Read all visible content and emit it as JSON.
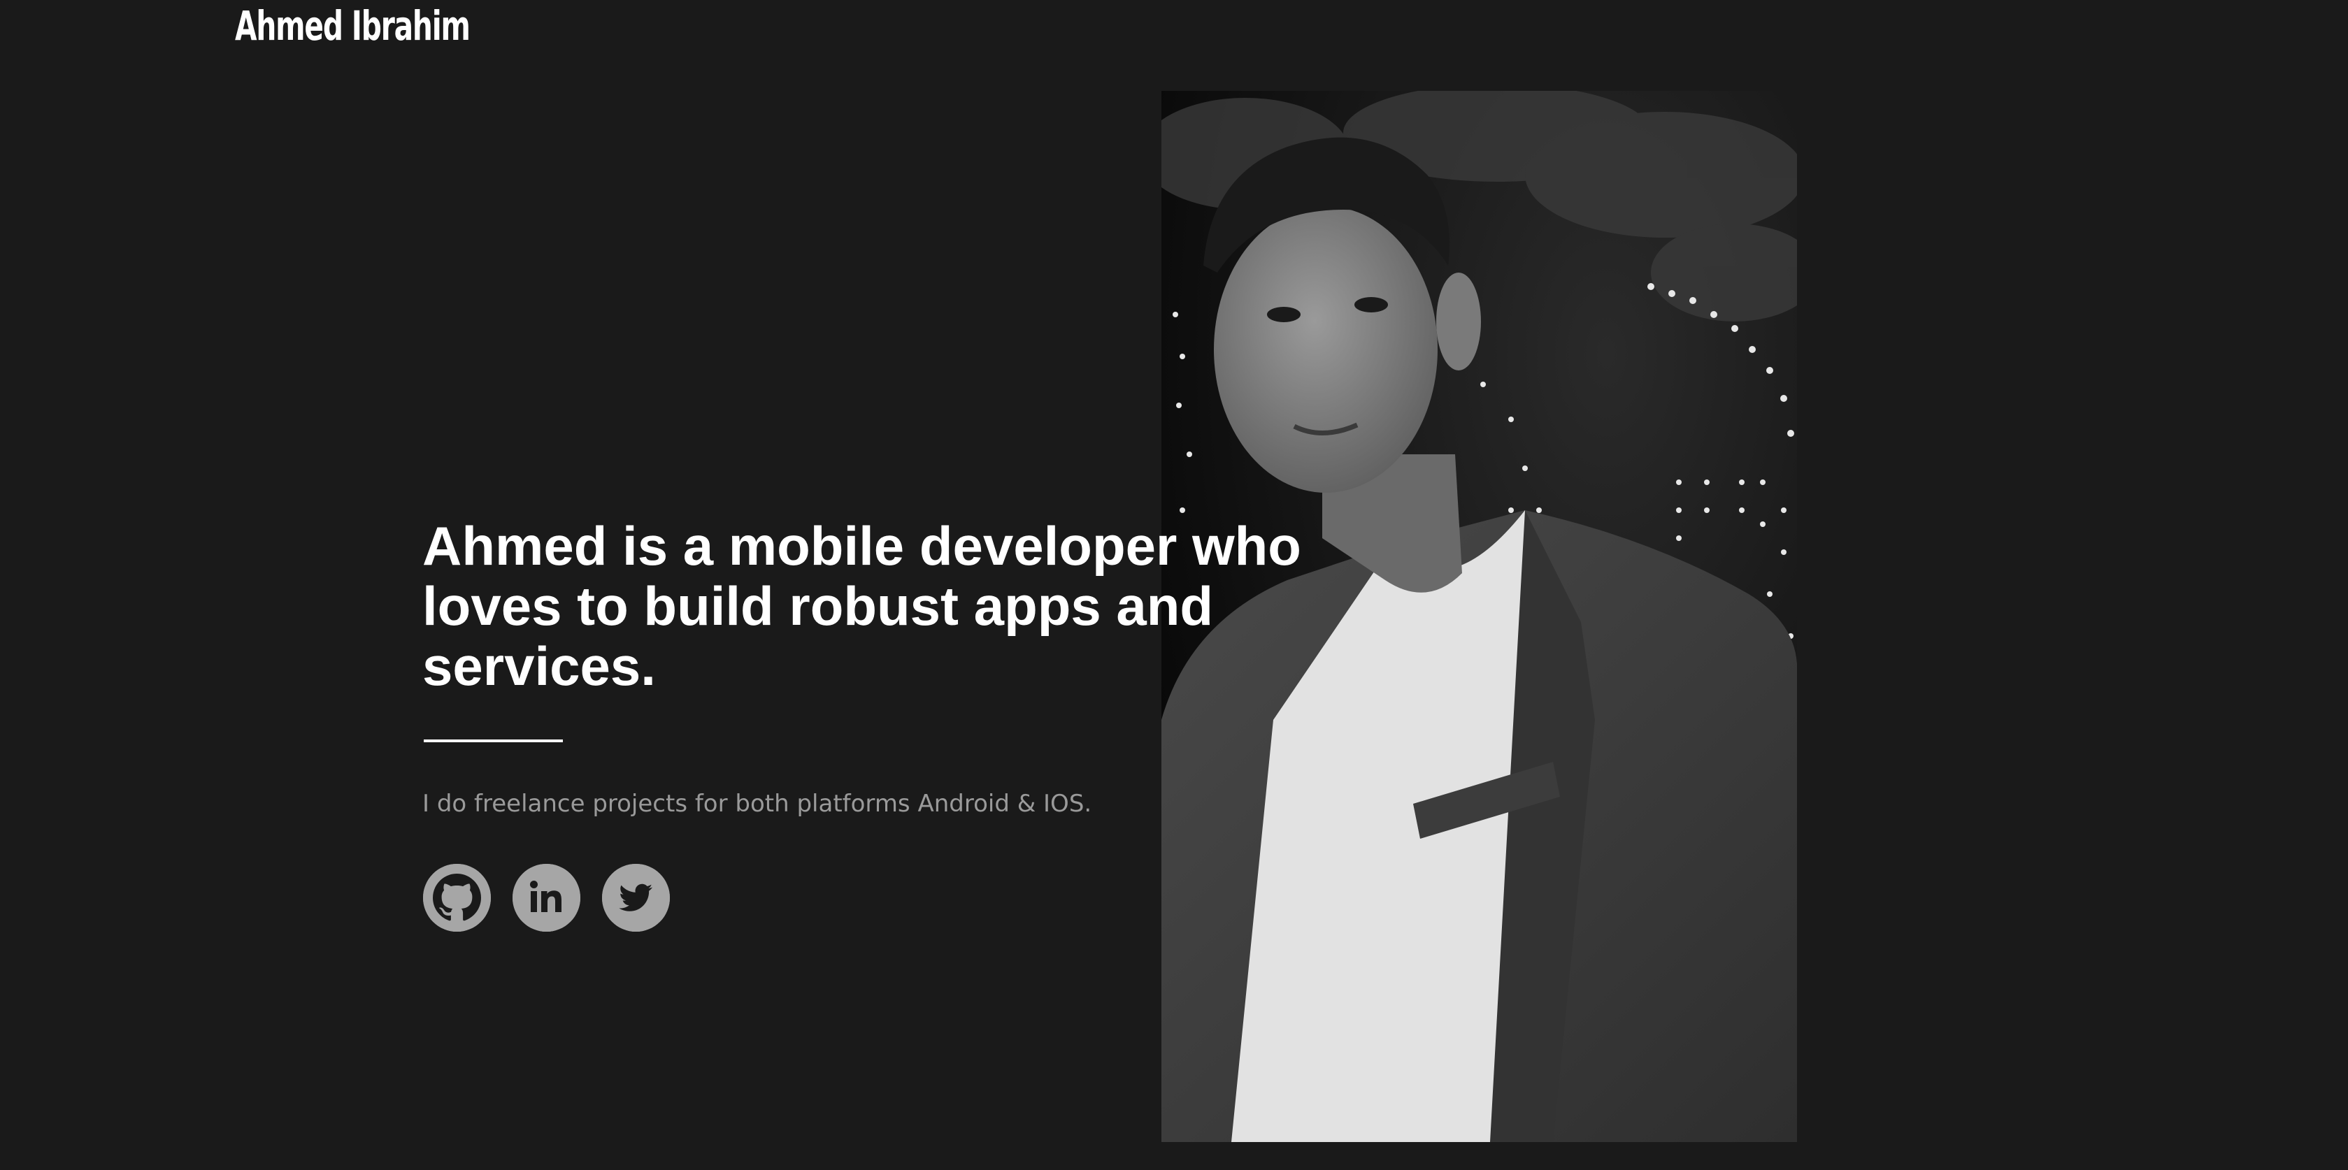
{
  "header": {
    "brand": "Ahmed Ibrahim"
  },
  "hero": {
    "headline_lines": [
      "Ahmed is a mobile developer who",
      "loves to build robust apps and",
      "services."
    ],
    "tagline": "I do freelance projects for both platforms Android & IOS.",
    "photo_icon": "portrait-photo"
  },
  "social": [
    {
      "icon": "github-icon"
    },
    {
      "icon": "linkedin-icon"
    },
    {
      "icon": "twitter-icon"
    }
  ],
  "colors": {
    "background": "#1a1a1a",
    "text": "#ffffff",
    "muted_text": "#9a9a9a",
    "social_icon_bg": "#a6a6a6",
    "social_icon_fg": "#1a1a1a"
  }
}
